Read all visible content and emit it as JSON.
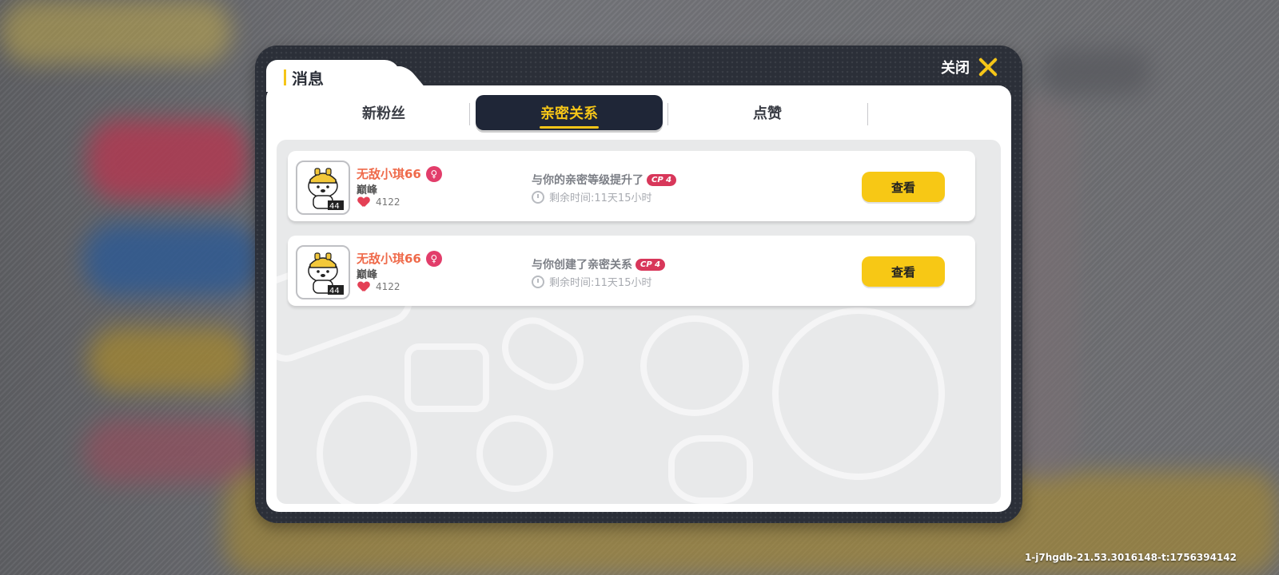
{
  "dialog": {
    "title": "消息",
    "close_label": "关闭"
  },
  "tabs": [
    {
      "label": "新粉丝",
      "selected": false
    },
    {
      "label": "亲密关系",
      "selected": true
    },
    {
      "label": "点赞",
      "selected": false
    }
  ],
  "messages": [
    {
      "name": "无敌小琪66",
      "gender_icon": "female-icon",
      "rank": "巅峰",
      "likes": "4122",
      "text": "与你的亲密等级提升了",
      "badge": "CP 4",
      "timer": "剩余时间:11天15小时",
      "button": "查看"
    },
    {
      "name": "无敌小琪66",
      "gender_icon": "female-icon",
      "rank": "巅峰",
      "likes": "4122",
      "text": "与你创建了亲密关系",
      "badge": "CP 4",
      "timer": "剩余时间:11天15小时",
      "button": "查看"
    }
  ],
  "footer": {
    "build_id": "1-j7hgdb-21.53.3016148-t:1756394142"
  },
  "colors": {
    "accent": "#f5c518",
    "tab_active_bg": "#1f2637",
    "name": "#ef6a4a",
    "cp_badge": "#d8375a",
    "frame": "#2b2f38"
  }
}
